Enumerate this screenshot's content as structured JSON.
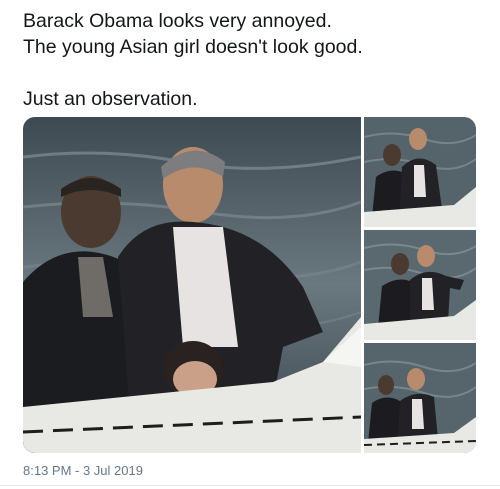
{
  "tweet": {
    "lines": [
      "Barack Obama looks very annoyed.",
      "The young Asian girl doesn't look good.",
      "Just an observation."
    ],
    "timestamp": "8:13 PM - 3 Jul 2019"
  },
  "media": {
    "photo_count": 4,
    "subjects": [
      "boat",
      "lake",
      "two men",
      "child"
    ]
  },
  "colors": {
    "text": "#14171a",
    "muted": "#657786",
    "water": "#4a5a66",
    "boat": "#e8e8e4"
  }
}
